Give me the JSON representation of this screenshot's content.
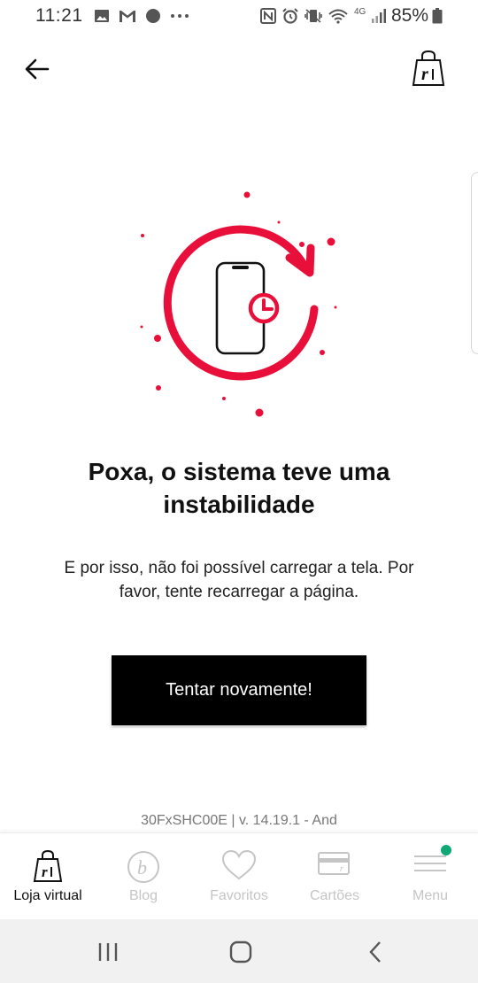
{
  "status_bar": {
    "time": "11:21",
    "battery": "85%",
    "network": "4G",
    "left_icons": [
      "gallery-icon",
      "gmail-icon",
      "chat-icon",
      "more-dots-icon"
    ],
    "right_icons": [
      "nfc-icon",
      "alarm-icon",
      "vibrate-icon",
      "wifi-icon",
      "signal-icon",
      "battery-icon"
    ]
  },
  "header": {
    "back_icon": "arrow-left-icon",
    "cart_icon": "shopping-bag-icon"
  },
  "error": {
    "title": "Poxa, o sistema teve uma instabilidade",
    "message": "E por isso, não foi possível carregar a tela. Por favor, tente recarregar a página.",
    "retry_label": "Tentar novamente!",
    "accent_color": "#e8103a"
  },
  "version_text": "30FxSHC00E | v. 14.19.1 - And",
  "bottom_nav": {
    "items": [
      {
        "label": "Loja virtual",
        "icon": "shopping-bag-icon",
        "active": true
      },
      {
        "label": "Blog",
        "icon": "blog-icon",
        "active": false
      },
      {
        "label": "Favoritos",
        "icon": "heart-icon",
        "active": false
      },
      {
        "label": "Cartões",
        "icon": "card-icon",
        "active": false
      },
      {
        "label": "Menu",
        "icon": "menu-icon",
        "active": false,
        "badge_color": "#12a875"
      }
    ]
  },
  "system_nav": {
    "recents_icon": "recents-icon",
    "home_icon": "home-icon",
    "back_icon": "back-chevron-icon"
  }
}
